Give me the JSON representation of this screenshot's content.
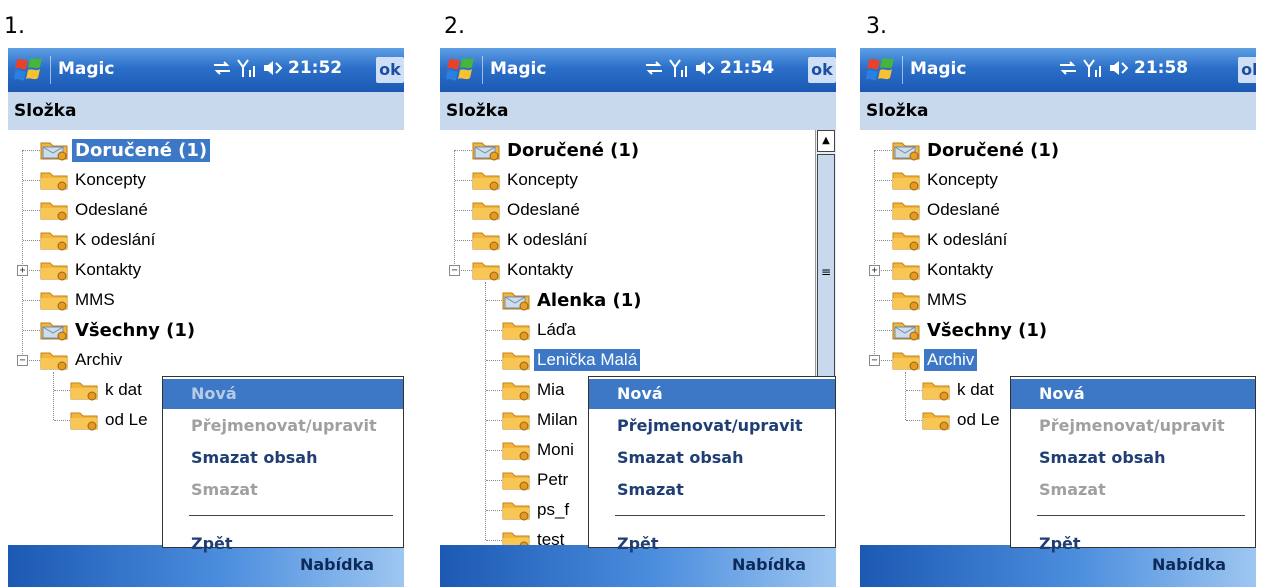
{
  "panels": [
    {
      "number": "1.",
      "app_title": "Magic",
      "clock": "21:52",
      "ok_label": "ok",
      "header": "Složka",
      "tree": [
        {
          "label": "Doručené (1)",
          "bold": true,
          "selected": true,
          "icon": "inbox-folder-icon"
        },
        {
          "label": "Koncepty",
          "icon": "folder-icon"
        },
        {
          "label": "Odeslané",
          "icon": "folder-icon"
        },
        {
          "label": "K odeslání",
          "icon": "folder-icon"
        },
        {
          "label": "Kontakty",
          "icon": "folder-icon",
          "expander": "+"
        },
        {
          "label": "MMS",
          "icon": "folder-icon"
        },
        {
          "label": "Všechny (1)",
          "bold": true,
          "icon": "inbox-folder-icon"
        },
        {
          "label": "Archiv",
          "icon": "folder-icon",
          "expander": "−"
        },
        {
          "label": "k dat",
          "icon": "folder-icon",
          "child": true
        },
        {
          "label": "od Le",
          "icon": "folder-icon",
          "child": true
        }
      ],
      "menu": {
        "items": [
          {
            "label": "Nová",
            "disabled": true,
            "highlighted": true
          },
          {
            "label": "Přejmenovat/upravit",
            "disabled": true
          },
          {
            "label": "Smazat obsah"
          },
          {
            "label": "Smazat",
            "disabled": true
          },
          {
            "label": "Zpět",
            "after_divider": true
          }
        ]
      },
      "softkey": "Nabídka"
    },
    {
      "number": "2.",
      "app_title": "Magic",
      "clock": "21:54",
      "ok_label": "ok",
      "header": "Složka",
      "tree": [
        {
          "label": "Doručené (1)",
          "bold": true,
          "icon": "inbox-folder-icon"
        },
        {
          "label": "Koncepty",
          "icon": "folder-icon"
        },
        {
          "label": "Odeslané",
          "icon": "folder-icon"
        },
        {
          "label": "K odeslání",
          "icon": "folder-icon"
        },
        {
          "label": "Kontakty",
          "icon": "folder-icon",
          "expander": "−"
        },
        {
          "label": "Alenka (1)",
          "bold": true,
          "icon": "inbox-folder-icon",
          "child": true
        },
        {
          "label": "Láďa",
          "icon": "folder-icon",
          "child": true
        },
        {
          "label": "Lenička Malá",
          "icon": "folder-icon",
          "child": true,
          "selected": true
        },
        {
          "label": "Mia",
          "icon": "folder-icon",
          "child": true
        },
        {
          "label": "Milan",
          "icon": "folder-icon",
          "child": true
        },
        {
          "label": "Moni",
          "icon": "folder-icon",
          "child": true
        },
        {
          "label": "Petr",
          "icon": "folder-icon",
          "child": true
        },
        {
          "label": "ps_f",
          "icon": "folder-icon",
          "child": true
        },
        {
          "label": "test",
          "icon": "folder-icon",
          "child": true
        }
      ],
      "menu": {
        "items": [
          {
            "label": "Nová",
            "highlighted": true
          },
          {
            "label": "Přejmenovat/upravit"
          },
          {
            "label": "Smazat obsah"
          },
          {
            "label": "Smazat"
          },
          {
            "label": "Zpět",
            "after_divider": true
          }
        ]
      },
      "softkey": "Nabídka"
    },
    {
      "number": "3.",
      "app_title": "Magic",
      "clock": "21:58",
      "ok_label": "ok",
      "header": "Složka",
      "tree": [
        {
          "label": "Doručené (1)",
          "bold": true,
          "icon": "inbox-folder-icon"
        },
        {
          "label": "Koncepty",
          "icon": "folder-icon"
        },
        {
          "label": "Odeslané",
          "icon": "folder-icon"
        },
        {
          "label": "K odeslání",
          "icon": "folder-icon"
        },
        {
          "label": "Kontakty",
          "icon": "folder-icon",
          "expander": "+"
        },
        {
          "label": "MMS",
          "icon": "folder-icon"
        },
        {
          "label": "Všechny (1)",
          "bold": true,
          "icon": "inbox-folder-icon"
        },
        {
          "label": "Archiv",
          "icon": "folder-icon",
          "expander": "−",
          "selected": true
        },
        {
          "label": "k dat",
          "icon": "folder-icon",
          "child": true
        },
        {
          "label": "od Le",
          "icon": "folder-icon",
          "child": true
        }
      ],
      "menu": {
        "items": [
          {
            "label": "Nová",
            "highlighted": true
          },
          {
            "label": "Přejmenovat/upravit",
            "disabled": true
          },
          {
            "label": "Smazat obsah"
          },
          {
            "label": "Smazat",
            "disabled": true
          },
          {
            "label": "Zpět",
            "after_divider": true
          }
        ]
      },
      "softkey": "Nabídka"
    }
  ],
  "colors": {
    "titlebar": "#2b6fc9",
    "header": "#c8d9ee",
    "selection": "#3c78c6",
    "menu_text": "#1f3e74",
    "disabled_text": "#a0a0a0"
  }
}
